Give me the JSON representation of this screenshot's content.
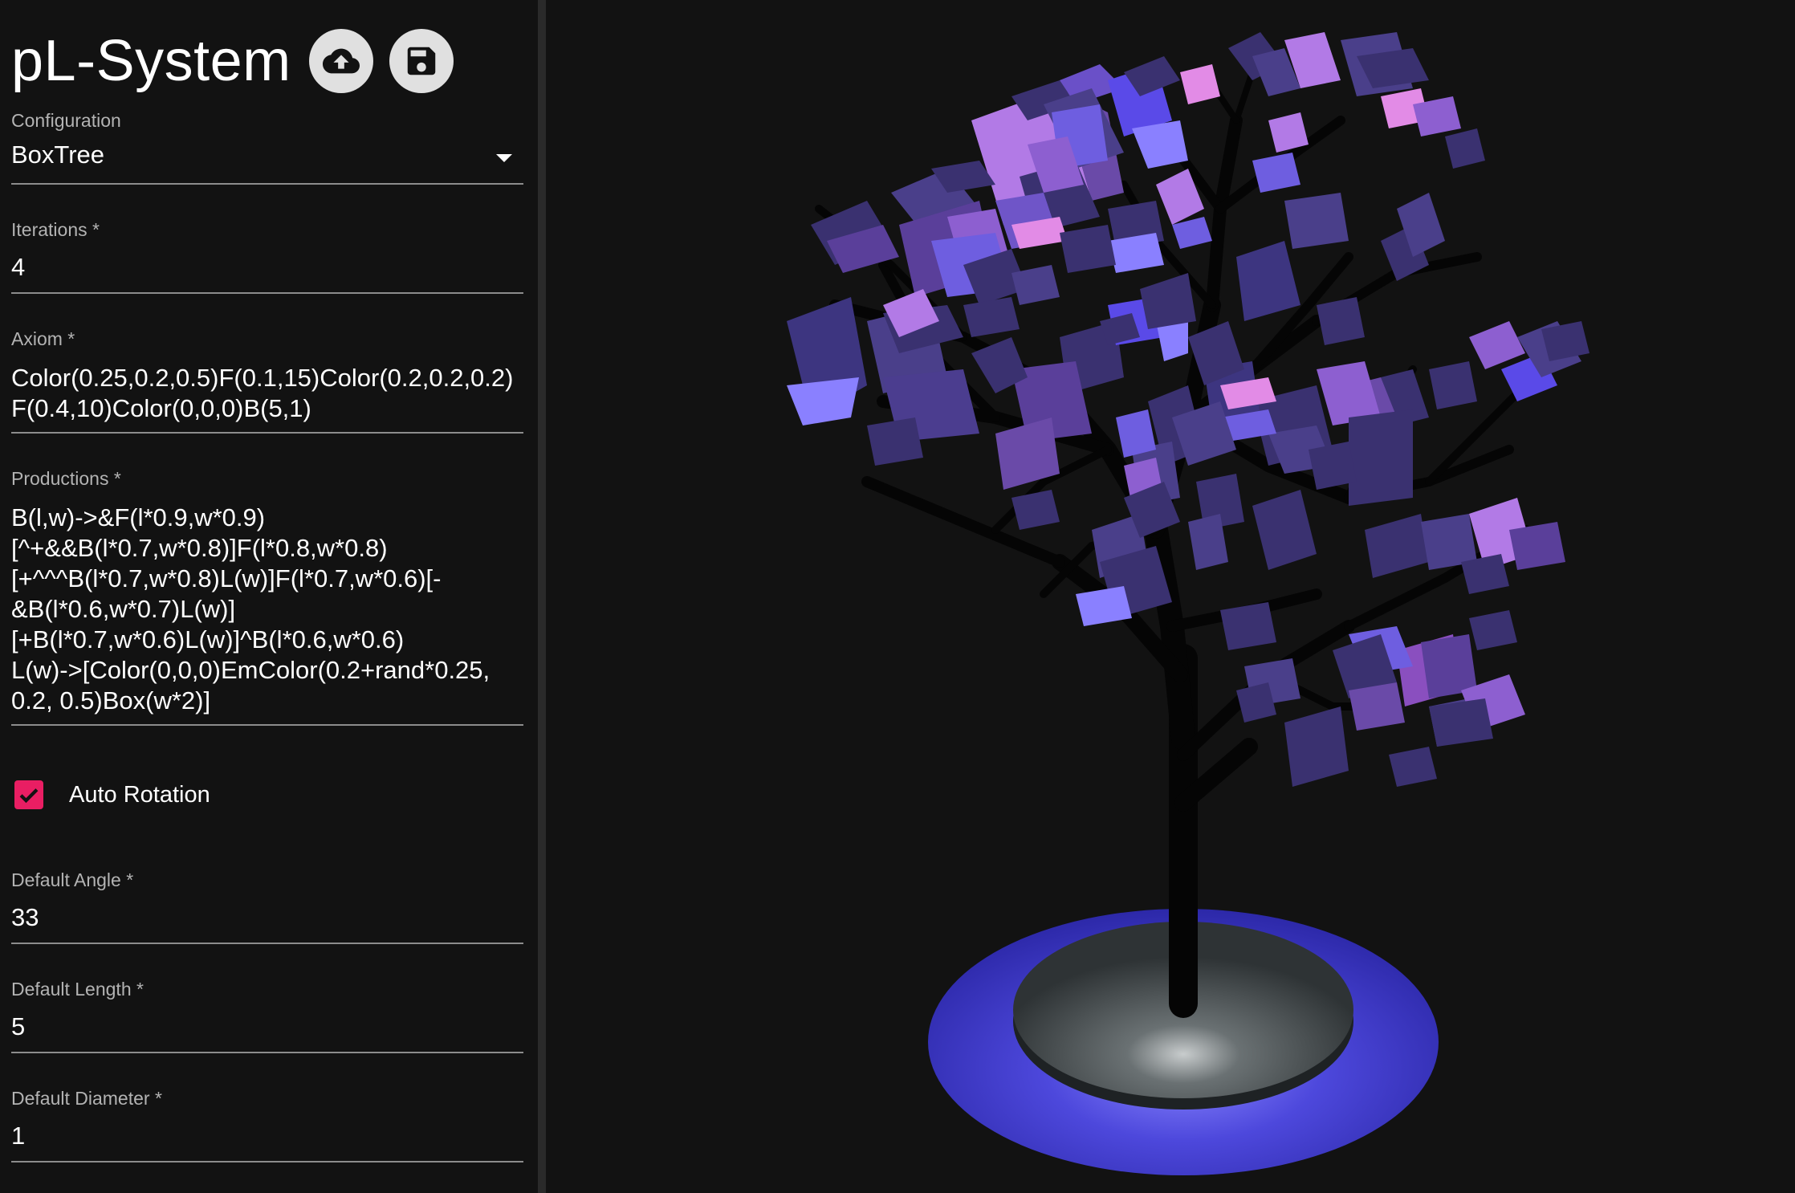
{
  "app": {
    "title": "pL-System"
  },
  "toolbar": {
    "upload_icon": "cloud-upload-icon",
    "save_icon": "save-icon"
  },
  "form": {
    "configuration": {
      "label": "Configuration",
      "value": "BoxTree"
    },
    "iterations": {
      "label": "Iterations *",
      "value": "4"
    },
    "axiom": {
      "label": "Axiom *",
      "value": "Color(0.25,0.2,0.5)F(0.1,15)Color(0.2,0.2,0.2)\nF(0.4,10)Color(0,0,0)B(5,1)"
    },
    "productions": {
      "label": "Productions *",
      "value": "B(l,w)->&F(l*0.9,w*0.9)\n[^+&&B(l*0.7,w*0.8)]F(l*0.8,w*0.8)\n[+^^^B(l*0.7,w*0.8)L(w)]F(l*0.7,w*0.6)[-\n&B(l*0.6,w*0.7)L(w)]\n[+B(l*0.7,w*0.6)L(w)]^B(l*0.6,w*0.6)\nL(w)->[Color(0,0,0)EmColor(0.2+rand*0.25,\n0.2, 0.5)Box(w*2)]"
    },
    "auto_rotation": {
      "label": "Auto Rotation",
      "checked": true
    },
    "default_angle": {
      "label": "Default Angle *",
      "value": "33"
    },
    "default_length": {
      "label": "Default Length *",
      "value": "5"
    },
    "default_diameter": {
      "label": "Default Diameter *",
      "value": "1"
    }
  },
  "colors": {
    "background": "#121212",
    "checkbox_accent": "#e91e63",
    "ring": "#4a46d8",
    "pedestal": "#3c4244",
    "leaf_light": "#b27ae6",
    "leaf_dark": "#3a3170"
  }
}
